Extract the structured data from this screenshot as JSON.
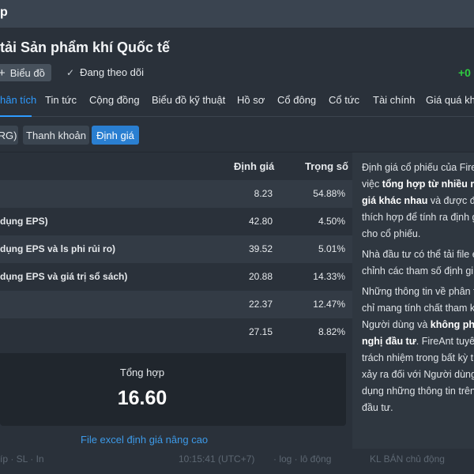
{
  "header": {
    "logo_fragment": "p",
    "company_title": "tải Sản phẩm khí Quốc tế",
    "chart_button": "Biểu đồ",
    "follow_label": "Đang theo dõi",
    "price_change": "+0"
  },
  "tabs": [
    {
      "label": "hân tích",
      "active": true
    },
    {
      "label": "Tin tức",
      "active": false
    },
    {
      "label": "Cộng đồng",
      "active": false
    },
    {
      "label": "Biểu đồ kỹ thuật",
      "active": false
    },
    {
      "label": "Hồ sơ",
      "active": false
    },
    {
      "label": "Cổ đông",
      "active": false
    },
    {
      "label": "Cổ tức",
      "active": false
    },
    {
      "label": "Tài chính",
      "active": false
    },
    {
      "label": "Giá quá khứ",
      "active": false
    }
  ],
  "chips": [
    {
      "label": "RG)",
      "active": false
    },
    {
      "label": "Thanh khoản",
      "active": false
    },
    {
      "label": "Định giá",
      "active": true
    }
  ],
  "table": {
    "col_value": "Định giá",
    "col_weight": "Trọng số",
    "rows": [
      {
        "name": "",
        "value": "8.23",
        "weight": "54.88%"
      },
      {
        "name": "dụng EPS)",
        "value": "42.80",
        "weight": "4.50%"
      },
      {
        "name": "dụng EPS và ls phi rủi ro)",
        "value": "39.52",
        "weight": "5.01%"
      },
      {
        "name": "dụng EPS và giá trị sổ sách)",
        "value": "20.88",
        "weight": "14.33%"
      },
      {
        "name": "",
        "value": "22.37",
        "weight": "12.47%"
      },
      {
        "name": "",
        "value": "27.15",
        "weight": "8.82%"
      }
    ]
  },
  "summary": {
    "label": "Tổng hợp",
    "value": "16.60"
  },
  "excel_link": "File excel định giá nâng cao",
  "info": {
    "l1": "Định giá cổ phiếu của Fire",
    "l2a": "việc ",
    "l2b": "tổng hợp từ nhiều m",
    "l3a": "giá khác nhau",
    "l3b": " và được đ",
    "l4": "thích hợp để tính ra định g",
    "l5": "cho cổ phiếu.",
    "l6": "Nhà đầu tư có thể tải file e",
    "l7": "chỉnh các tham số định gi",
    "l8": "Những thông tin về phân t",
    "l9": "chỉ mang tính chất tham k",
    "l10a": "Người dùng và ",
    "l10b": "không phả",
    "l11a": "nghị đầu tư",
    "l11b": ". FireAnt tuyê",
    "l12": "trách nhiệm trong bất kỳ t",
    "l13": "xảy ra đối với Người dùng",
    "l14": "dụng những thông tin trên",
    "l15": "đầu tư."
  },
  "bottom": {
    "t1": "íp · SL · In",
    "t2": "10:15:41 (UTC+7)",
    "t3": "· log · lô động",
    "t4": "KL BÁN chủ động"
  }
}
